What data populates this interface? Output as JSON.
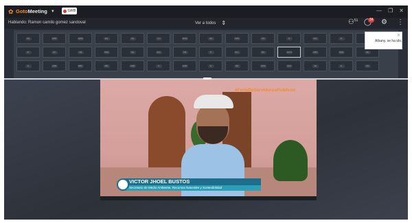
{
  "app": {
    "name_prefix": "Goto",
    "name_suffix": "Meeting",
    "recording_label": "GRB"
  },
  "toolbar": {
    "speaking_text": "Hablando: Ramon camilo gomez sandoval",
    "view_label": "Ver a todos",
    "attendee_count": "51",
    "chat_badge": "34"
  },
  "toast": {
    "message": "Albany, se ha ido."
  },
  "grid": {
    "rows": [
      [
        "AE",
        "AMR",
        "AMM",
        "EG",
        "AE",
        "GI",
        "MMS",
        "AE",
        "KMS",
        "AR",
        "G",
        "CRL",
        "D",
        "CR"
      ],
      [
        "IP",
        "AP",
        "AM",
        "SRG",
        "SE",
        "ANL",
        "PM",
        "B",
        "EFL",
        "DO",
        "NGCS",
        "AMS",
        "MRE",
        "FE"
      ],
      [
        "G",
        "ANB",
        "MBL",
        "ZBL",
        "AMR",
        "G",
        "AMR",
        "G",
        "RE",
        "HPM",
        "CES",
        "JE",
        "G",
        "HM",
        "ARM"
      ]
    ],
    "selected": "NGCS"
  },
  "video": {
    "hashtag": "#FeriaDeServidoresPublicos",
    "name": "VICTOR JHOEL BUSTOS",
    "role": "Secretario de Medio Ambiente, Recursos Naturales y Sostenibilidad"
  },
  "colors": {
    "accent": "#f68d2e",
    "record": "#e53935",
    "lower_third": "#1f6d8c"
  }
}
